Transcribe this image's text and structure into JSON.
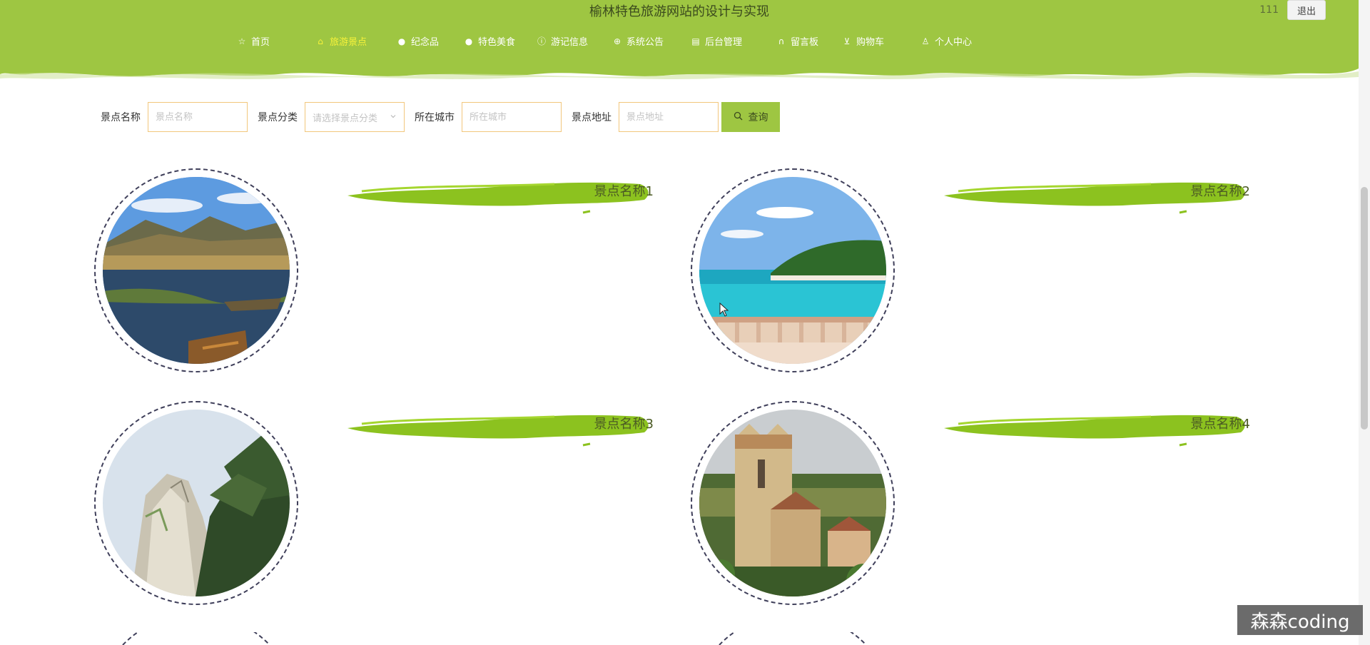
{
  "header": {
    "title": "榆林特色旅游网站的设计与实现",
    "username": "111",
    "logout_label": "退出",
    "bg_color": "#9ec642",
    "nav": [
      {
        "label": "首页",
        "icon": "star-icon",
        "active": false
      },
      {
        "label": "旅游景点",
        "icon": "bag-icon",
        "active": true
      },
      {
        "label": "纪念品",
        "icon": "dot-icon",
        "active": false
      },
      {
        "label": "特色美食",
        "icon": "dot-icon",
        "active": false
      },
      {
        "label": "游记信息",
        "icon": "info-icon",
        "active": false
      },
      {
        "label": "系统公告",
        "icon": "globe-icon",
        "active": false
      },
      {
        "label": "后台管理",
        "icon": "clipboard-icon",
        "active": false
      },
      {
        "label": "留言板",
        "icon": "headset-icon",
        "active": false
      },
      {
        "label": "购物车",
        "icon": "cart-icon",
        "active": false
      },
      {
        "label": "个人中心",
        "icon": "user-icon",
        "active": false
      }
    ]
  },
  "search": {
    "name_label": "景点名称",
    "name_placeholder": "景点名称",
    "category_label": "景点分类",
    "category_placeholder": "请选择景点分类",
    "city_label": "所在城市",
    "city_placeholder": "所在城市",
    "address_label": "景点地址",
    "address_placeholder": "景点地址",
    "button_label": "查询"
  },
  "cards": [
    {
      "name": "景点名称1",
      "image": "lake-mountains-boats"
    },
    {
      "name": "景点名称2",
      "image": "tropical-beach-balcony"
    },
    {
      "name": "景点名称3",
      "image": "cliff-pine-trees"
    },
    {
      "name": "景点名称4",
      "image": "church-tower-village"
    }
  ],
  "watermark": "森森coding"
}
